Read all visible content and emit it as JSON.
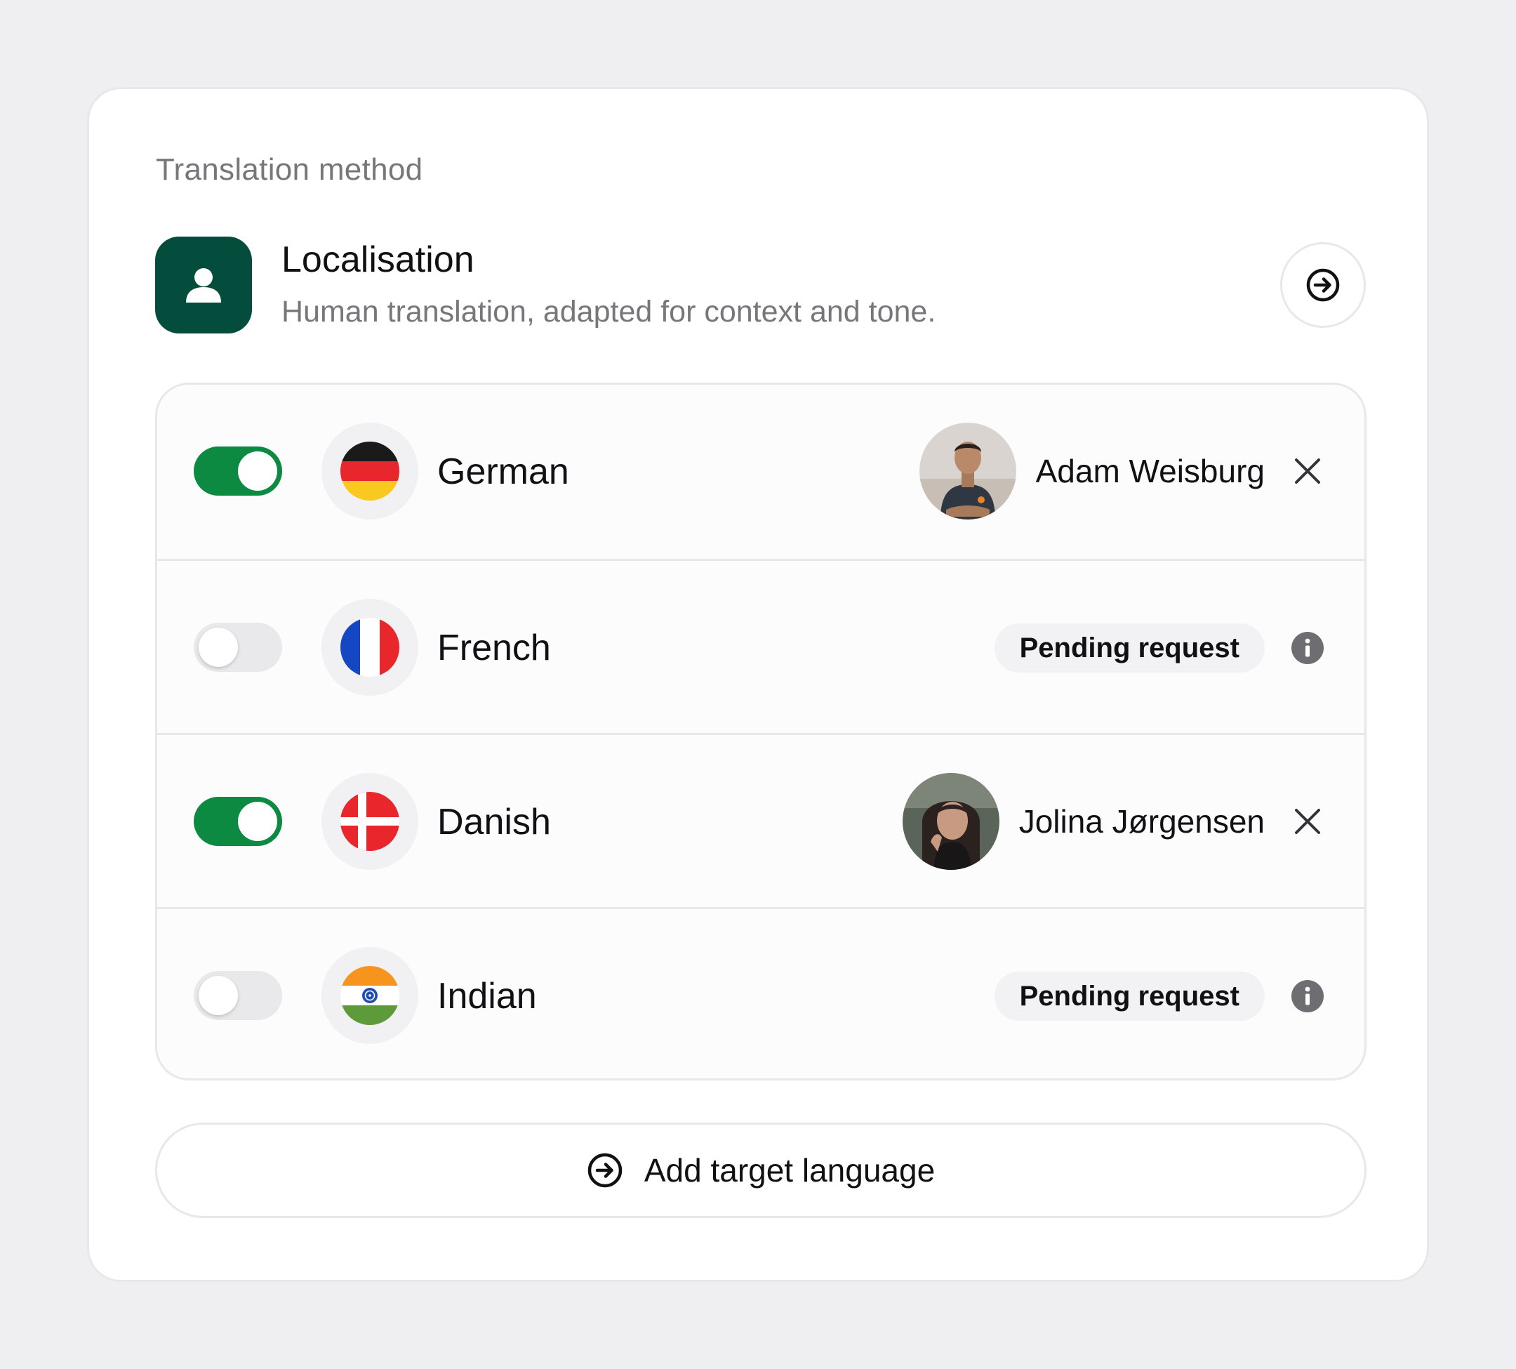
{
  "section_label": "Translation method",
  "method": {
    "title": "Localisation",
    "description": "Human translation, adapted for context and tone.",
    "icon": "person-icon",
    "icon_color": "#044d3d"
  },
  "languages": [
    {
      "name": "German",
      "enabled": true,
      "flag": "german-flag-icon",
      "assignee": "Adam Weisburg"
    },
    {
      "name": "French",
      "enabled": false,
      "flag": "french-flag-icon",
      "status": "Pending request"
    },
    {
      "name": "Danish",
      "enabled": true,
      "flag": "danish-flag-icon",
      "assignee": "Jolina Jørgensen"
    },
    {
      "name": "Indian",
      "enabled": false,
      "flag": "indian-flag-icon",
      "status": "Pending request"
    }
  ],
  "add_button": {
    "label": "Add target language",
    "icon": "arrow-circle-icon"
  },
  "colors": {
    "toggle_on": "#0c8a41",
    "toggle_off": "#e9e8eb",
    "background": "#efeef1"
  }
}
